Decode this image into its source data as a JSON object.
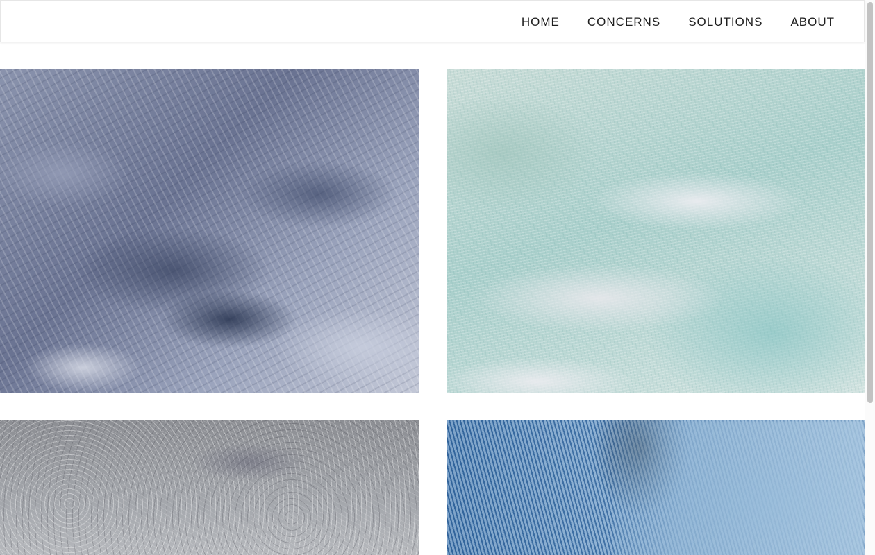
{
  "nav": {
    "items": [
      {
        "label": "HOME"
      },
      {
        "label": "CONCERNS"
      },
      {
        "label": "SOLUTIONS"
      },
      {
        "label": "ABOUT"
      }
    ]
  },
  "gallery": {
    "tiles": [
      {
        "subject": "blue-grey shaggy wool fur"
      },
      {
        "subject": "fringed mint woven blanket"
      },
      {
        "subject": "tangled grey threads"
      },
      {
        "subject": "blue knit fabric"
      }
    ]
  },
  "colors": {
    "nav_text": "#1d1d1d",
    "background": "#ffffff",
    "nav_border": "#e6e6e6"
  }
}
